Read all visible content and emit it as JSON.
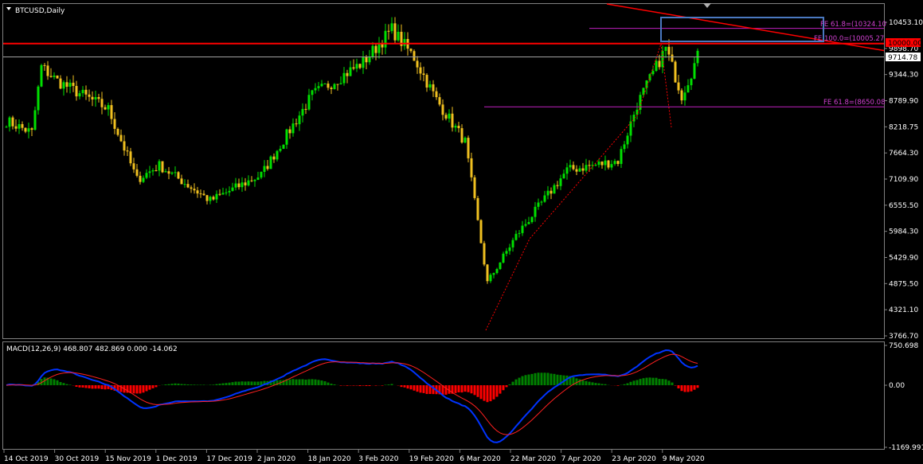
{
  "window": {
    "title": "BTCUSD,Daily"
  },
  "indicator": {
    "label": "MACD(12,26,9) 468.807 482.869 0.000 -14.062"
  },
  "price_axis": {
    "ticks": [
      "10453.10",
      "9898.70",
      "9344.30",
      "8789.90",
      "8218.75",
      "7664.30",
      "7109.90",
      "6555.50",
      "5984.30",
      "5429.90",
      "4875.50",
      "4321.10",
      "3766.70"
    ],
    "current_price": "9714.78",
    "level_label": "10000.00"
  },
  "macd_axis": {
    "ticks": [
      "750.698",
      "0.00",
      "-1169.991"
    ]
  },
  "date_axis": {
    "ticks": [
      "14 Oct 2019",
      "30 Oct 2019",
      "15 Nov 2019",
      "1 Dec 2019",
      "17 Dec 2019",
      "2 Jan 2020",
      "18 Jan 2020",
      "3 Feb 2020",
      "19 Feb 2020",
      "6 Mar 2020",
      "22 Mar 2020",
      "7 Apr 2020",
      "23 Apr 2020",
      "9 May 2020"
    ]
  },
  "annotations": {
    "fe_top": "FE 61.8=(10324.10",
    "fe_mid": "FE 100.0=(10005.27",
    "fe_low": "FE 61.8=(8650.08"
  },
  "colors": {
    "bull": "#00e000",
    "bear": "#f0c020",
    "macd": "#0033ff",
    "signal": "#ff2020",
    "hist_pos": "#008000",
    "hist_neg": "#ff0000",
    "fib": "#c020c0",
    "resistance": "#ff0000",
    "box": "#4a78c0"
  },
  "chart_data": {
    "type": "candlestick",
    "title": "BTCUSD,Daily",
    "y_range": [
      3766.7,
      10453.1
    ],
    "price_series": [
      {
        "date": "14 Oct 2019",
        "close": 8350
      },
      {
        "date": "22 Oct 2019",
        "close": 8100
      },
      {
        "date": "25 Oct 2019",
        "close": 9500
      },
      {
        "date": "30 Oct 2019",
        "close": 9200
      },
      {
        "date": "15 Nov 2019",
        "close": 8600
      },
      {
        "date": "24 Nov 2019",
        "close": 7100
      },
      {
        "date": "1 Dec 2019",
        "close": 7400
      },
      {
        "date": "17 Dec 2019",
        "close": 6650
      },
      {
        "date": "2 Jan 2020",
        "close": 7200
      },
      {
        "date": "18 Jan 2020",
        "close": 8900
      },
      {
        "date": "3 Feb 2020",
        "close": 9600
      },
      {
        "date": "12 Feb 2020",
        "close": 10300
      },
      {
        "date": "19 Feb 2020",
        "close": 9700
      },
      {
        "date": "26 Feb 2020",
        "close": 8800
      },
      {
        "date": "6 Mar 2020",
        "close": 7900
      },
      {
        "date": "13 Mar 2020",
        "close": 4900
      },
      {
        "date": "22 Mar 2020",
        "close": 5900
      },
      {
        "date": "7 Apr 2020",
        "close": 7300
      },
      {
        "date": "23 Apr 2020",
        "close": 7500
      },
      {
        "date": "29 Apr 2020",
        "close": 8700
      },
      {
        "date": "8 May 2020",
        "close": 9900
      },
      {
        "date": "13 May 2020",
        "close": 8900
      },
      {
        "date": "18 May 2020",
        "close": 9714.78
      }
    ],
    "levels": [
      {
        "name": "resistance",
        "value": 10000
      },
      {
        "name": "FE 61.8",
        "value": 10324.1
      },
      {
        "name": "FE 100.0",
        "value": 10005.27
      },
      {
        "name": "FE 61.8",
        "value": 8650.08
      }
    ],
    "macd": {
      "params": "12,26,9",
      "values": [
        468.807,
        482.869,
        0.0,
        -14.062
      ],
      "y_range": [
        -1169.991,
        750.698
      ]
    }
  }
}
